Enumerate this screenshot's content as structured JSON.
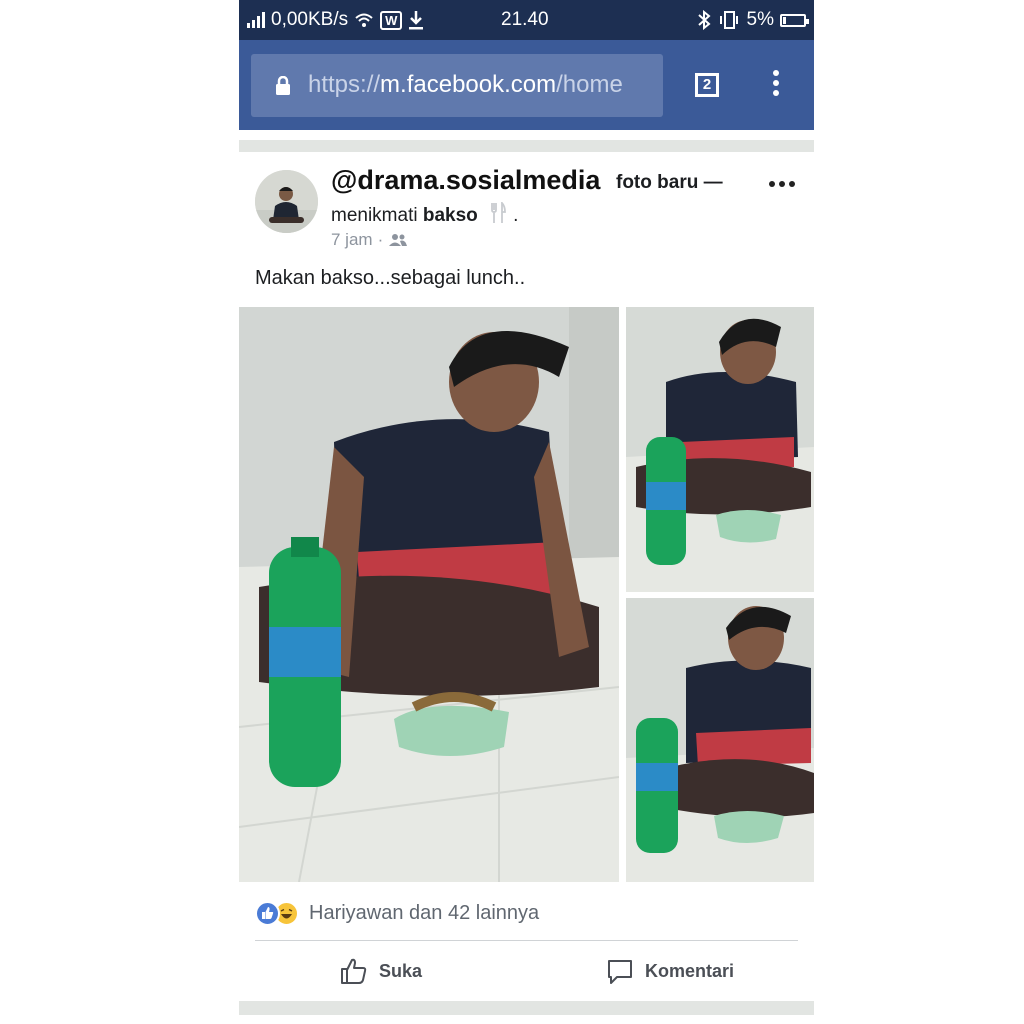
{
  "status_bar": {
    "network_speed": "0,00KB/s",
    "time": "21.40",
    "battery": "5%"
  },
  "browser": {
    "url_scheme": "https://",
    "url_host": "m.facebook.com",
    "url_path": "/home",
    "tab_count": "2"
  },
  "post": {
    "author": "@drama.sosialmedia",
    "action": "foto baru —",
    "feeling_prefix": "menikmati",
    "feeling_object": "bakso",
    "feeling_suffix": ".",
    "time": "7 jam",
    "meta_separator": "·",
    "audience_icon": "friends-icon",
    "text": "Makan bakso...sebagai lunch..",
    "reactions_text": "Hariyawan dan 42 lainnya",
    "like_label": "Suka",
    "comment_label": "Komentari"
  },
  "colors": {
    "status_bar_bg": "#1d2f52",
    "browser_bar_bg": "#3b5a98",
    "like_blue": "#4a7bd6",
    "haha_yellow": "#f7c43a"
  }
}
